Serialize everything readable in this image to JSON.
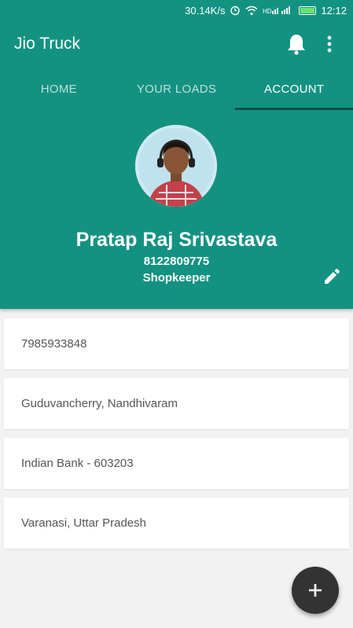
{
  "status_bar": {
    "speed": "30.14K/s",
    "time": "12:12",
    "icons": [
      "alarm-icon",
      "wifi-icon",
      "signal-icon",
      "battery-icon"
    ]
  },
  "appbar": {
    "title": "Jio Truck",
    "actions": [
      "bell-icon",
      "more-vert-icon"
    ]
  },
  "tabs": [
    {
      "label": "HOME",
      "active": false
    },
    {
      "label": "YOUR LOADS",
      "active": false
    },
    {
      "label": "ACCOUNT",
      "active": true
    }
  ],
  "profile": {
    "name": "Pratap Raj Srivastava",
    "phone": "8122809775",
    "role": "Shopkeeper"
  },
  "details": [
    "7985933848",
    "Guduvancherry, Nandhivaram",
    "Indian Bank - 603203",
    "Varanasi, Uttar Pradesh"
  ],
  "colors": {
    "primary": "#139282",
    "tab_indicator": "#0d4f48",
    "fab": "#333333",
    "background": "#f2f2f2"
  }
}
